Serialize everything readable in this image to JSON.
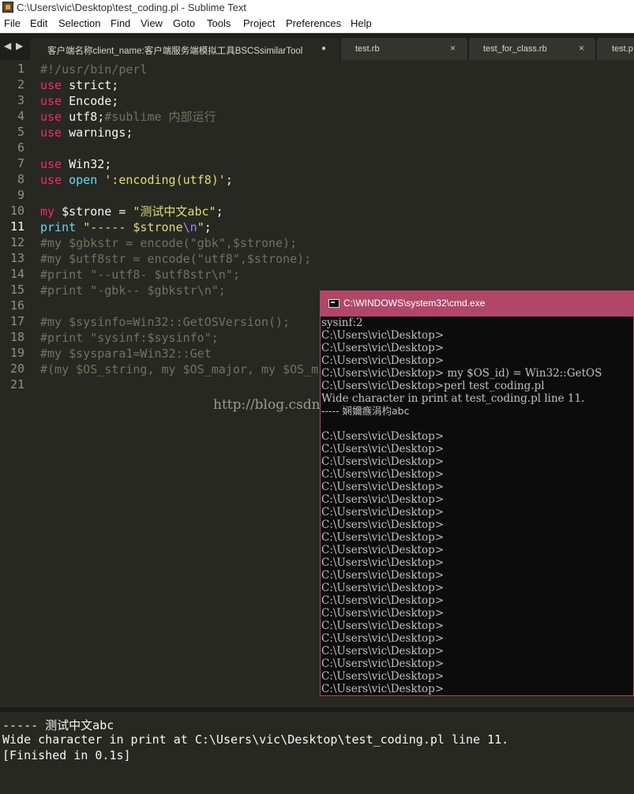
{
  "window": {
    "title": "C:\\Users\\vic\\Desktop\\test_coding.pl - Sublime Text"
  },
  "menu": [
    "File",
    "Edit",
    "Selection",
    "Find",
    "View",
    "Goto",
    "Tools",
    "Project",
    "Preferences",
    "Help"
  ],
  "tab_nav": {
    "left": "◀",
    "right": "▶"
  },
  "tabs": [
    {
      "label": "客户端名称client_name:客户端服务端模拟工具BSCSsimilarTool",
      "close": "●"
    },
    {
      "label": "test.rb",
      "close": "×"
    },
    {
      "label": "test_for_class.rb",
      "close": "×"
    },
    {
      "label": "test.p",
      "close": ""
    }
  ],
  "editor": {
    "line_numbers": [
      "1",
      "2",
      "3",
      "4",
      "5",
      "6",
      "7",
      "8",
      "9",
      "10",
      "11",
      "12",
      "13",
      "14",
      "15",
      "16",
      "17",
      "18",
      "19",
      "20",
      "21"
    ],
    "current_line": "11",
    "lines": {
      "l1": {
        "c": "#!/usr/bin/perl"
      },
      "l2": {
        "kw": "use",
        "t": " strict;"
      },
      "l3": {
        "kw": "use",
        "t": " Encode;"
      },
      "l4": {
        "kw": "use",
        "t": " utf8;",
        "c": "#sublime 内部运行"
      },
      "l5": {
        "kw": "use",
        "t": " warnings;"
      },
      "l7": {
        "kw": "use",
        "t": " Win32;"
      },
      "l8": {
        "kw": "use",
        "k2": "open",
        "s": "':encoding(utf8)'",
        "t": ";"
      },
      "l10": {
        "kw": "my",
        "t": " $strone = ",
        "s": "\"测试中文abc\"",
        "t2": ";"
      },
      "l11": {
        "kw": "print",
        "s1": "\"----- $strone",
        "esc": "\\n",
        "s2": "\"",
        "t": ";"
      },
      "l12": {
        "c": "#my $gbkstr = encode(\"gbk\",$strone);"
      },
      "l13": {
        "c": "#my $utf8str = encode(\"utf8\",$strone);"
      },
      "l14": {
        "c": "#print \"--utf8- $utf8str\\n\";"
      },
      "l15": {
        "c": "#print \"-gbk-- $gbkstr\\n\";"
      },
      "l17": {
        "c": "#my $sysinfo=Win32::GetOSVersion();"
      },
      "l18": {
        "c": "#print \"sysinf:$sysinfo\";"
      },
      "l19": {
        "c": "#my $syspara1=Win32::Get"
      },
      "l20": {
        "c": "#(my $OS_string, my $OS_major, my $OS_mi"
      }
    },
    "watermark": "http://blog.csdn.n"
  },
  "cmd": {
    "title": "C:\\WINDOWS\\system32\\cmd.exe",
    "lines": [
      "sysinf:2",
      "C:\\Users\\vic\\Desktop>",
      "C:\\Users\\vic\\Desktop>",
      "C:\\Users\\vic\\Desktop>",
      "C:\\Users\\vic\\Desktop>  my $OS_id) = Win32::GetOS",
      "C:\\Users\\vic\\Desktop>perl test_coding.pl",
      "Wide character in print at test_coding.pl line 11.",
      "----- 娴嬭瘯涓枃abc",
      "",
      "C:\\Users\\vic\\Desktop>",
      "C:\\Users\\vic\\Desktop>",
      "C:\\Users\\vic\\Desktop>",
      "C:\\Users\\vic\\Desktop>",
      "C:\\Users\\vic\\Desktop>",
      "C:\\Users\\vic\\Desktop>",
      "C:\\Users\\vic\\Desktop>",
      "C:\\Users\\vic\\Desktop>",
      "C:\\Users\\vic\\Desktop>",
      "C:\\Users\\vic\\Desktop>",
      "C:\\Users\\vic\\Desktop>",
      "C:\\Users\\vic\\Desktop>",
      "C:\\Users\\vic\\Desktop>",
      "C:\\Users\\vic\\Desktop>",
      "C:\\Users\\vic\\Desktop>",
      "C:\\Users\\vic\\Desktop>",
      "C:\\Users\\vic\\Desktop>",
      "C:\\Users\\vic\\Desktop>",
      "C:\\Users\\vic\\Desktop>",
      "C:\\Users\\vic\\Desktop>",
      "C:\\Users\\vic\\Desktop>"
    ]
  },
  "output": {
    "lines": [
      "----- 测试中文abc",
      "Wide character in print at C:\\Users\\vic\\Desktop\\test_coding.pl line 11.",
      "[Finished in 0.1s]"
    ]
  },
  "colors": {
    "keyword": "#f92672",
    "string": "#e6db74",
    "comment": "#75715e",
    "cyan": "#66d9ef",
    "cmd_title": "#b04769"
  }
}
